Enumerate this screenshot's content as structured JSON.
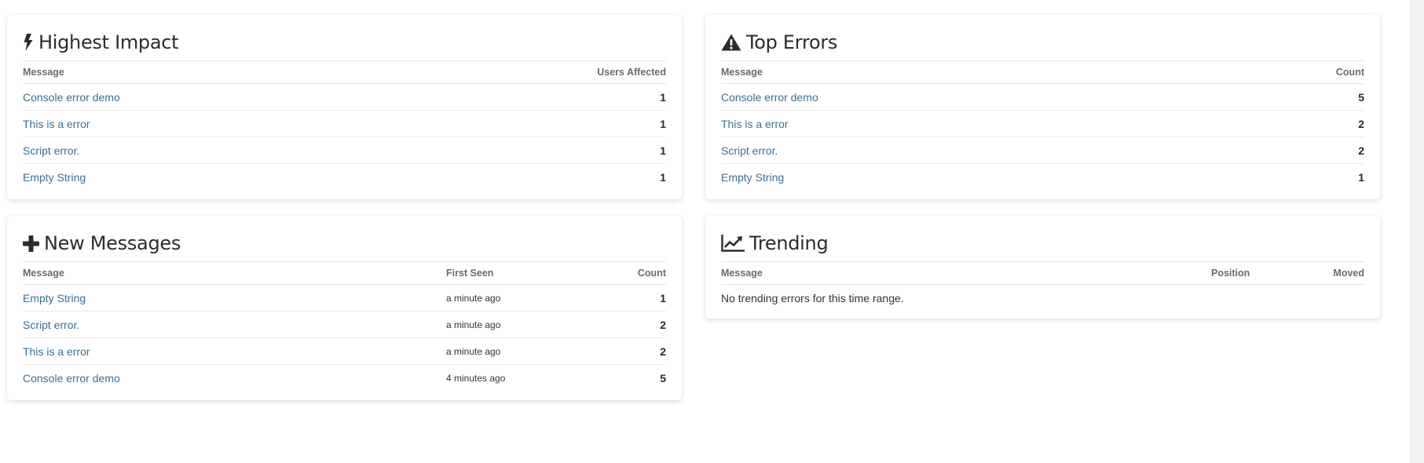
{
  "highest_impact": {
    "title": "Highest Impact",
    "icon": "bolt-icon",
    "headers": {
      "message": "Message",
      "users_affected": "Users Affected"
    },
    "rows": [
      {
        "message": "Console error demo",
        "users_affected": "1"
      },
      {
        "message": "This is a error",
        "users_affected": "1"
      },
      {
        "message": "Script error.",
        "users_affected": "1"
      },
      {
        "message": "Empty String",
        "users_affected": "1"
      }
    ]
  },
  "top_errors": {
    "title": "Top Errors",
    "icon": "warning-icon",
    "headers": {
      "message": "Message",
      "count": "Count"
    },
    "rows": [
      {
        "message": "Console error demo",
        "count": "5"
      },
      {
        "message": "This is a error",
        "count": "2"
      },
      {
        "message": "Script error.",
        "count": "2"
      },
      {
        "message": "Empty String",
        "count": "1"
      }
    ]
  },
  "new_messages": {
    "title": "New Messages",
    "icon": "plus-icon",
    "headers": {
      "message": "Message",
      "first_seen": "First Seen",
      "count": "Count"
    },
    "rows": [
      {
        "message": "Empty String",
        "first_seen": "a minute ago",
        "count": "1"
      },
      {
        "message": "Script error.",
        "first_seen": "a minute ago",
        "count": "2"
      },
      {
        "message": "This is a error",
        "first_seen": "a minute ago",
        "count": "2"
      },
      {
        "message": "Console error demo",
        "first_seen": "4 minutes ago",
        "count": "5"
      }
    ]
  },
  "trending": {
    "title": "Trending",
    "icon": "line-chart-icon",
    "headers": {
      "message": "Message",
      "position": "Position",
      "moved": "Moved"
    },
    "empty_text": "No trending errors for this time range."
  },
  "colors": {
    "link": "#3a6f94",
    "title": "#2b2b2b",
    "header": "#6b6b6b"
  }
}
